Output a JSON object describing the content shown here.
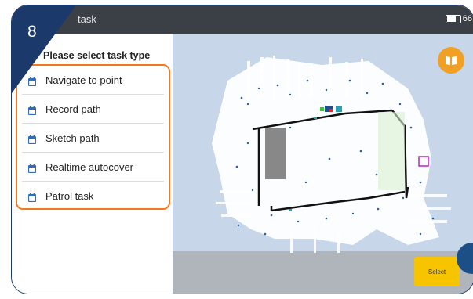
{
  "header": {
    "title": "task",
    "battery_text": "66"
  },
  "badge": {
    "number": "8"
  },
  "panel": {
    "heading": "Please select task type",
    "items": [
      {
        "label": "Navigate to point"
      },
      {
        "label": "Record path"
      },
      {
        "label": "Sketch path"
      },
      {
        "label": "Realtime autocover"
      },
      {
        "label": "Patrol task"
      }
    ]
  },
  "actions": {
    "select_label": "Select"
  },
  "colors": {
    "accent": "#f07a21",
    "badge": "#1b3a6b",
    "topbar": "#3b4046",
    "select": "#f7c400",
    "map_bg": "#c7d6e8"
  },
  "icons": {
    "item_icon": "calendar-icon",
    "book_icon": "book-icon"
  }
}
